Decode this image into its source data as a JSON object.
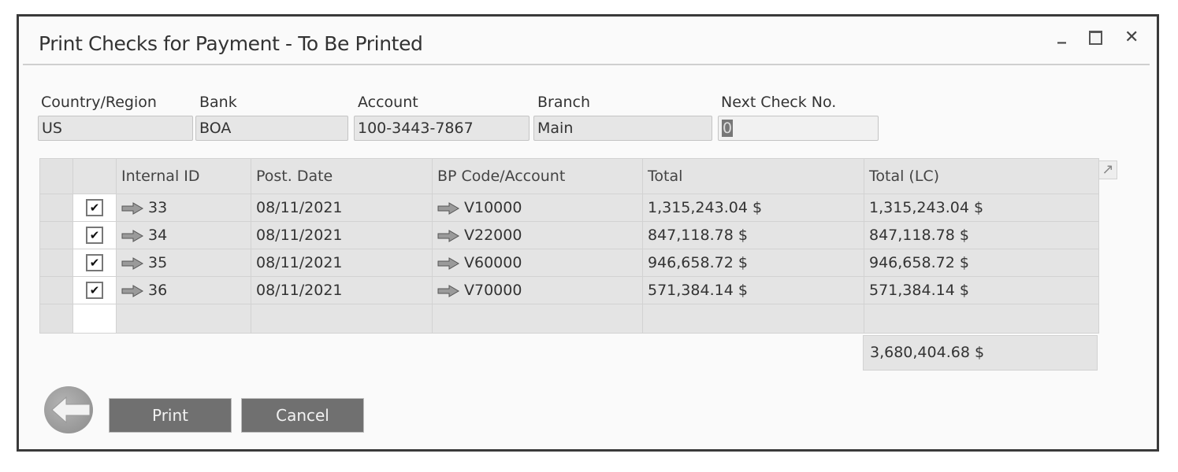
{
  "window": {
    "title": "Print Checks for Payment - To Be Printed",
    "controls": {
      "minimize": "_",
      "maximize": "",
      "close": "✕"
    }
  },
  "header_fields": [
    {
      "label": "Country/Region",
      "value": "US"
    },
    {
      "label": "Bank",
      "value": "BOA"
    },
    {
      "label": "Account",
      "value": "100-3443-7867"
    },
    {
      "label": "Branch",
      "value": "Main"
    },
    {
      "label": "Next Check No.",
      "value": "0"
    }
  ],
  "grid": {
    "columns": [
      "",
      "",
      "Internal ID",
      "Post. Date",
      "BP Code/Account",
      "Total",
      "Total (LC)"
    ],
    "rows": [
      {
        "checked": true,
        "internal_id": "33",
        "post_date": "08/11/2021",
        "bp_code": "V10000",
        "total": "1,315,243.04 $",
        "total_lc": "1,315,243.04 $"
      },
      {
        "checked": true,
        "internal_id": "34",
        "post_date": "08/11/2021",
        "bp_code": "V22000",
        "total": "847,118.78 $",
        "total_lc": "847,118.78 $"
      },
      {
        "checked": true,
        "internal_id": "35",
        "post_date": "08/11/2021",
        "bp_code": "V60000",
        "total": "946,658.72 $",
        "total_lc": "946,658.72 $"
      },
      {
        "checked": true,
        "internal_id": "36",
        "post_date": "08/11/2021",
        "bp_code": "V70000",
        "total": "571,384.14 $",
        "total_lc": "571,384.14 $"
      }
    ],
    "sum_total_lc": "3,680,404.68 $",
    "check_glyph": "✔",
    "expand_glyph": "↗"
  },
  "buttons": {
    "print": "Print",
    "cancel": "Cancel"
  },
  "icons": {
    "row_link": "link-arrow-icon",
    "back": "back-arrow-icon"
  }
}
